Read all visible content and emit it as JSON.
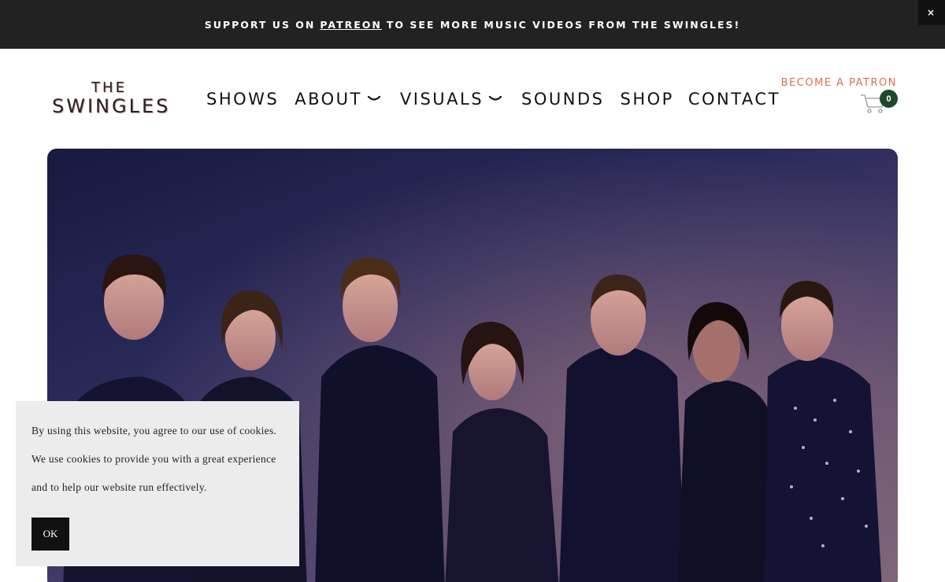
{
  "announcement": {
    "before": "SUPPORT US ON",
    "link": "PATREON",
    "after": "TO SEE MORE MUSIC VIDEOS FROM THE SWINGLES!",
    "close_label": "×"
  },
  "logo": {
    "line1": "THE",
    "line2": "SWINGLES"
  },
  "nav": {
    "shows": "SHOWS",
    "about": "ABOUT",
    "visuals": "VISUALS",
    "sounds": "SOUNDS",
    "shop": "SHOP",
    "contact": "CONTACT"
  },
  "header": {
    "become_patron": "BECOME A PATRON",
    "cart_count": "0"
  },
  "cookie": {
    "line1": "By using this website, you agree to our use of cookies.",
    "line2": "We use cookies to provide you with a great experience",
    "line3": "and to help our website run effectively.",
    "ok_label": "OK"
  },
  "colors": {
    "announcement_bg": "#222222",
    "accent": "#d4734c",
    "cart_badge": "#1f4a2a",
    "cookie_bg": "#ececec"
  },
  "icons": {
    "cart": "shopping-cart-icon",
    "chevron": "chevron-down-icon",
    "close": "close-icon"
  }
}
